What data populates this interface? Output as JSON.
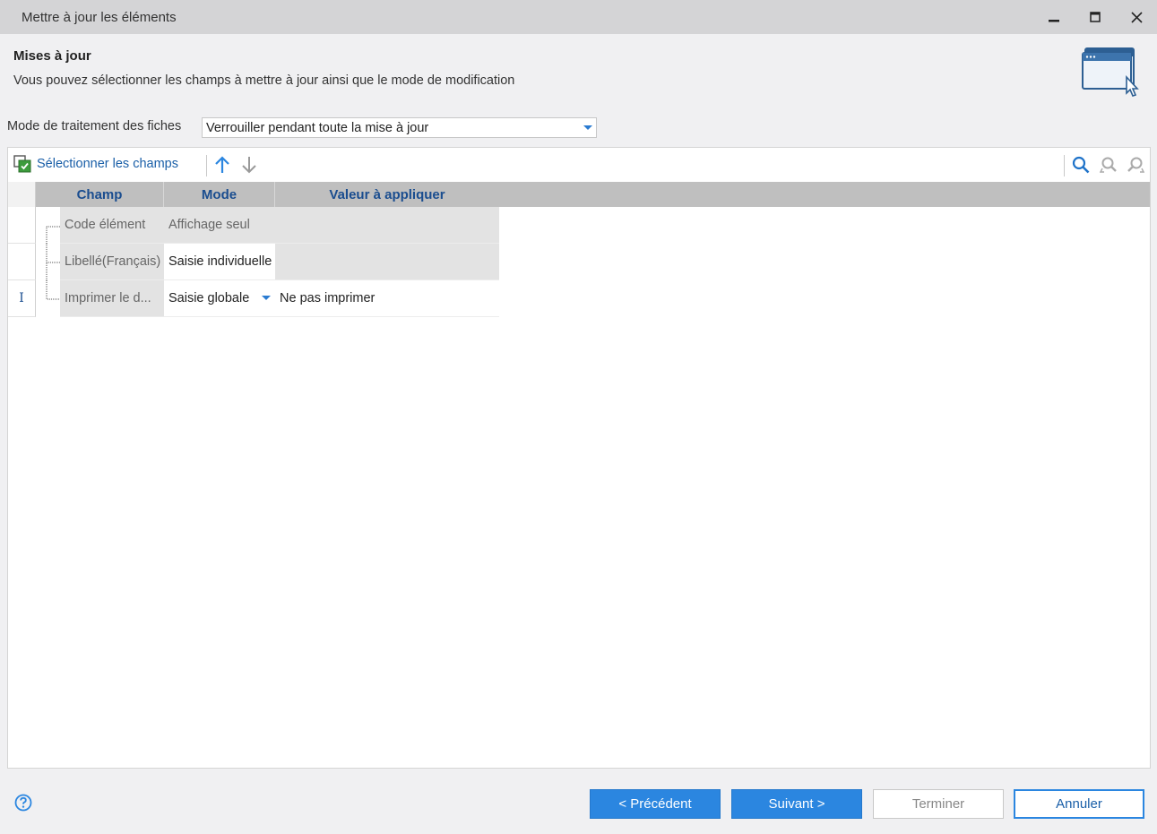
{
  "window": {
    "title": "Mettre à jour les éléments",
    "minimize": "━",
    "maximize": "☐",
    "close": "✕"
  },
  "header": {
    "title": "Mises à jour",
    "description": "Vous pouvez sélectionner les champs à mettre à jour ainsi que le mode de modification",
    "icon": "window-cursor-icon"
  },
  "mode": {
    "label": "Mode de traitement des fiches",
    "selected": "Verrouiller pendant toute la mise à jour"
  },
  "toolbar": {
    "select_fields_label": "Sélectionner les champs"
  },
  "grid": {
    "columns": [
      "Champ",
      "Mode",
      "Valeur à appliquer"
    ],
    "rows": [
      {
        "marker": "",
        "champ": "Code élément",
        "mode": "Affichage seul",
        "valeur": ""
      },
      {
        "marker": "",
        "champ": "Libellé(Français)",
        "mode": "Saisie individuelle",
        "valeur": ""
      },
      {
        "marker": "I",
        "champ": "Imprimer le d...",
        "mode": "Saisie globale",
        "valeur": "Ne pas imprimer"
      }
    ]
  },
  "footer": {
    "previous": "< Précédent",
    "next": "Suivant >",
    "finish": "Terminer",
    "cancel": "Annuler"
  },
  "colors": {
    "accent": "#2b86e0",
    "header_text": "#1a4d8f",
    "grid_header_bg": "#bfbfbf"
  }
}
